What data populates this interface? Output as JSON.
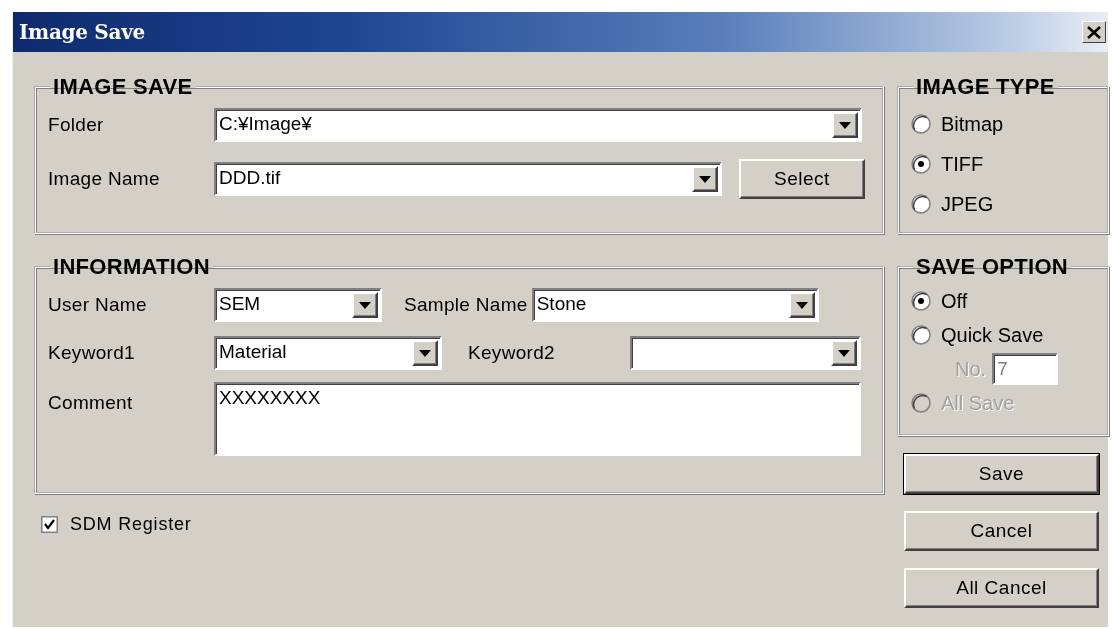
{
  "window": {
    "title": "Image Save"
  },
  "image_save": {
    "title": "IMAGE SAVE",
    "folder": {
      "label": "Folder",
      "value": "C:¥Image¥"
    },
    "image_name": {
      "label": "Image Name",
      "value": "DDD.tif"
    },
    "select_button": "Select"
  },
  "information": {
    "title": "INFORMATION",
    "user_name": {
      "label": "User Name",
      "value": "SEM"
    },
    "sample_name": {
      "label": "Sample Name",
      "value": "Stone"
    },
    "keyword1": {
      "label": "Keyword1",
      "value": "Material"
    },
    "keyword2": {
      "label": "Keyword2"
    },
    "comment": {
      "label": "Comment",
      "value": "XXXXXXXX"
    }
  },
  "sdm_register": {
    "label": "SDM Register",
    "checked": true
  },
  "image_type": {
    "title": "IMAGE TYPE",
    "options": [
      {
        "label": "Bitmap",
        "selected": false
      },
      {
        "label": "TIFF",
        "selected": true
      },
      {
        "label": "JPEG",
        "selected": false
      }
    ]
  },
  "save_option": {
    "title": "SAVE OPTION",
    "options": [
      {
        "label": "Off",
        "selected": true,
        "disabled": false
      },
      {
        "label": "Quick Save",
        "selected": false,
        "disabled": false
      },
      {
        "label": "All Save",
        "selected": false,
        "disabled": true
      }
    ],
    "number": {
      "label": "No.",
      "value": "7",
      "disabled": true
    }
  },
  "buttons": [
    {
      "label": "Save",
      "default": true
    },
    {
      "label": "Cancel",
      "default": false
    },
    {
      "label": "All Cancel",
      "default": false
    }
  ]
}
